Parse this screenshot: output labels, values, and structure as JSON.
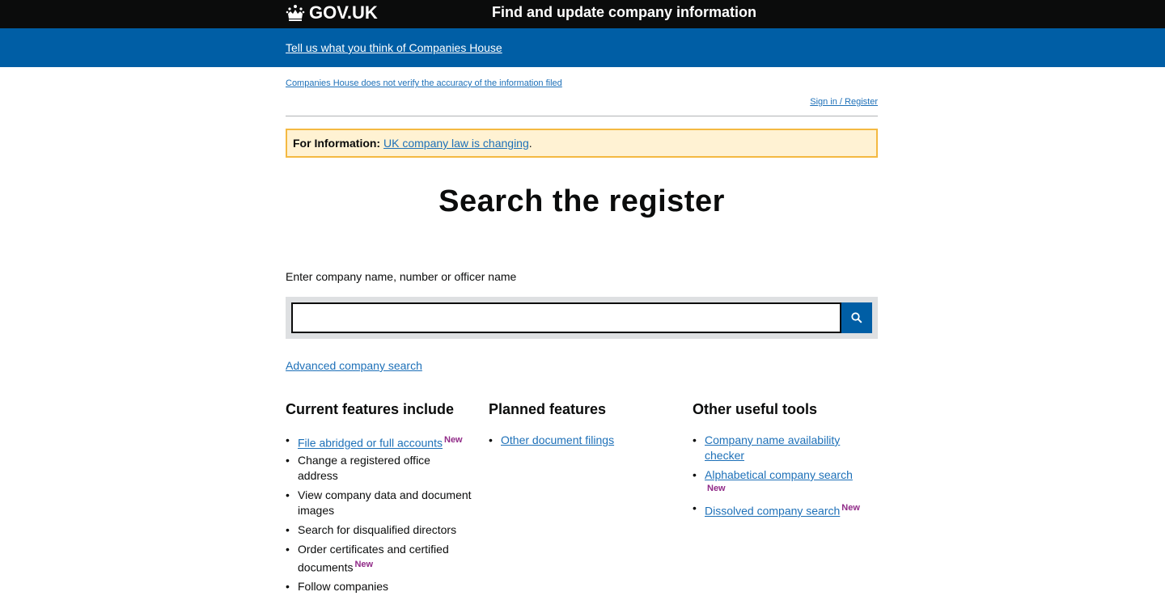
{
  "header": {
    "logo_text": "GOV.UK",
    "service_name": "Find and update company information"
  },
  "banner": {
    "feedback_link": "Tell us what you think of Companies House"
  },
  "notices": {
    "disclaimer": "Companies House does not verify the accuracy of the information filed",
    "signin": "Sign in / Register"
  },
  "info_panel": {
    "label": "For Information:",
    "link": "UK company law is changing",
    "suffix": "."
  },
  "main": {
    "title": "Search the register",
    "search_label": "Enter company name, number or officer name",
    "search_value": "",
    "advanced_link": "Advanced company search"
  },
  "badge_new": "New",
  "current_features": {
    "heading": "Current features include",
    "items": [
      "File abridged or full accounts",
      "Change a registered office address",
      "View company data and document images",
      "Search for disqualified directors",
      "Order certificates and certified documents",
      "Follow companies"
    ]
  },
  "planned_features": {
    "heading": "Planned features",
    "items": [
      "Other document filings"
    ]
  },
  "other_tools": {
    "heading": "Other useful tools",
    "items": [
      "Company name availability checker",
      "Alphabetical company search",
      "Dissolved company search"
    ]
  },
  "colors": {
    "header_bg": "#0b0c0c",
    "banner_bg": "#005ea5",
    "link": "#1d70b8",
    "new_badge": "#912b88",
    "info_bg": "#fff2d3",
    "info_border": "#f4b942"
  }
}
